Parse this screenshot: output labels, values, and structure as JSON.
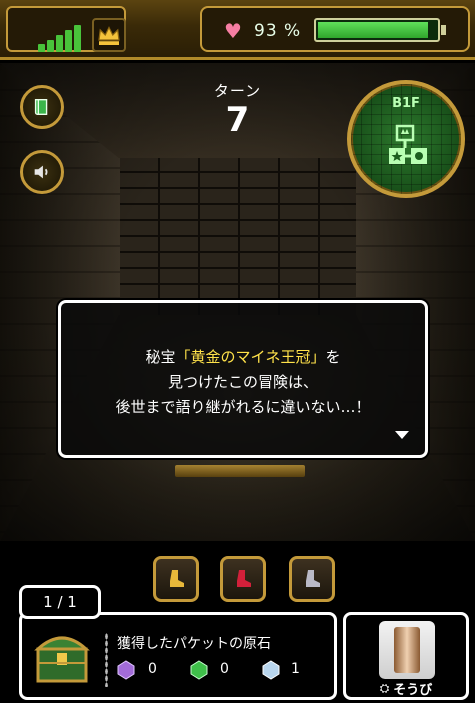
{
  "status_bar": {
    "hp_text": "93 %",
    "hp_percent": 93,
    "signal_bars": 5,
    "icons": [
      "signal-icon",
      "crown-icon",
      "heart-icon"
    ]
  },
  "turn": {
    "label": "ターン",
    "value": "7"
  },
  "minimap": {
    "floor": "B1F"
  },
  "message": {
    "line1_pre": "秘宝",
    "line1_highlight": "「黄金のマイネ王冠」",
    "line1_post": "を",
    "line2": "見つけたこの冒険は、",
    "line3": "後世まで語り継がれるに違いない…！"
  },
  "items": [
    {
      "icon": "gold-boot-icon",
      "color": "#e8b83a"
    },
    {
      "icon": "red-boot-icon",
      "color": "#d2203a"
    },
    {
      "icon": "silver-boot-icon",
      "color": "#b9b9c6"
    }
  ],
  "loot": {
    "counter": "1 / 1",
    "title": "獲得したパケットの原石",
    "gems": [
      {
        "icon": "purple-gem-icon",
        "color": "#a26bd8",
        "count": "0"
      },
      {
        "icon": "green-gem-icon",
        "color": "#3fbf4a",
        "count": "0"
      },
      {
        "icon": "blue-gem-icon",
        "color": "#b9d6ee",
        "count": "1"
      }
    ]
  },
  "equip": {
    "label": "そうび"
  },
  "colors": {
    "accent_gold": "#c49a3a",
    "hp_green": "#49c33a",
    "highlight_yellow": "#ffe24a"
  }
}
